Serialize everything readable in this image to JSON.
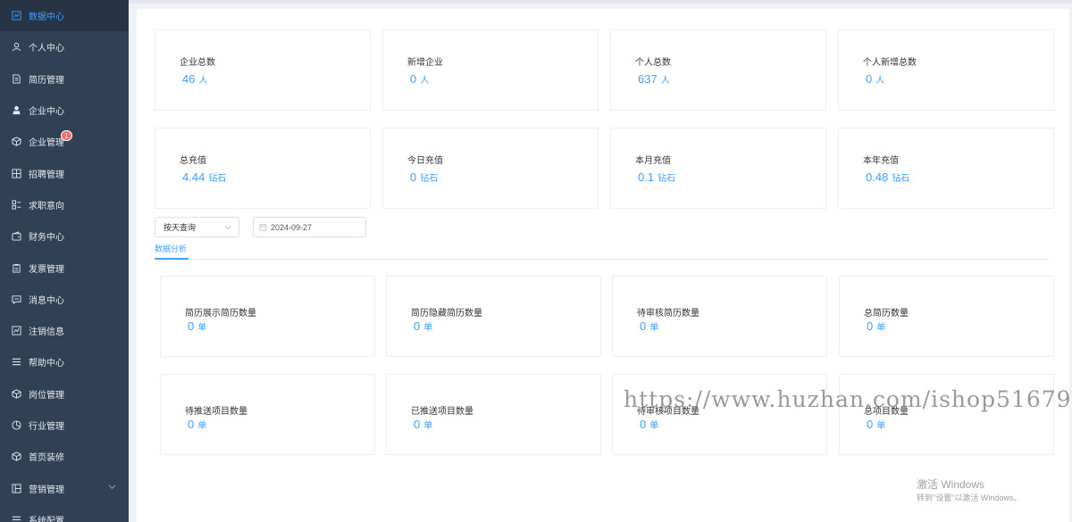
{
  "sidebar": {
    "items": [
      {
        "label": "数据中心",
        "icon": "chart-line-icon",
        "active": true
      },
      {
        "label": "个人中心",
        "icon": "user-icon"
      },
      {
        "label": "简历管理",
        "icon": "document-icon"
      },
      {
        "label": "企业中心",
        "icon": "user-solid-icon"
      },
      {
        "label": "企业管理",
        "icon": "box-icon",
        "badge": "1"
      },
      {
        "label": "招聘管理",
        "icon": "grid-icon"
      },
      {
        "label": "求职意向",
        "icon": "apps-icon"
      },
      {
        "label": "财务中心",
        "icon": "wallet-icon"
      },
      {
        "label": "发票管理",
        "icon": "clipboard-icon"
      },
      {
        "label": "消息中心",
        "icon": "message-icon"
      },
      {
        "label": "注销信息",
        "icon": "chart-line-icon"
      },
      {
        "label": "帮助中心",
        "icon": "list-icon"
      },
      {
        "label": "岗位管理",
        "icon": "box-icon"
      },
      {
        "label": "行业管理",
        "icon": "pie-chart-icon"
      },
      {
        "label": "首页装修",
        "icon": "box-icon"
      },
      {
        "label": "营销管理",
        "icon": "layout-icon",
        "has_submenu": true
      },
      {
        "label": "系统配置",
        "icon": "list-icon"
      }
    ]
  },
  "stats_top": [
    {
      "title": "企业总数",
      "value": "46",
      "unit": "人"
    },
    {
      "title": "新增企业",
      "value": "0",
      "unit": "人"
    },
    {
      "title": "个人总数",
      "value": "637",
      "unit": "人"
    },
    {
      "title": "个人新增总数",
      "value": "0",
      "unit": "人"
    },
    {
      "title": "总充值",
      "value": "4.44",
      "unit": "钻石"
    },
    {
      "title": "今日充值",
      "value": "0",
      "unit": "钻石"
    },
    {
      "title": "本月充值",
      "value": "0.1",
      "unit": "钻石"
    },
    {
      "title": "本年充值",
      "value": "0.48",
      "unit": "钻石"
    }
  ],
  "filters": {
    "query_mode": "按天查询",
    "date": "2024-09-27"
  },
  "tabs": {
    "active": "数据分析"
  },
  "stats_bottom": [
    {
      "title": "简历展示简历数量",
      "value": "0",
      "unit": "单"
    },
    {
      "title": "简历隐藏简历数量",
      "value": "0",
      "unit": "单"
    },
    {
      "title": "待审核简历数量",
      "value": "0",
      "unit": "单"
    },
    {
      "title": "总简历数量",
      "value": "0",
      "unit": "单"
    },
    {
      "title": "待推送项目数量",
      "value": "0",
      "unit": "单"
    },
    {
      "title": "已推送项目数量",
      "value": "0",
      "unit": "单"
    },
    {
      "title": "待审核项目数量",
      "value": "0",
      "unit": "单"
    },
    {
      "title": "总项目数量",
      "value": "0",
      "unit": "单"
    }
  ],
  "overlay": {
    "watermark": "https://www.huzhan.com/ishop51679",
    "windows_line1": "激活 Windows",
    "windows_line2": "转到\"设置\"以激活 Windows。"
  },
  "colors": {
    "accent": "#409eff",
    "sidebar": "#304156",
    "badge": "#f56c6c"
  }
}
